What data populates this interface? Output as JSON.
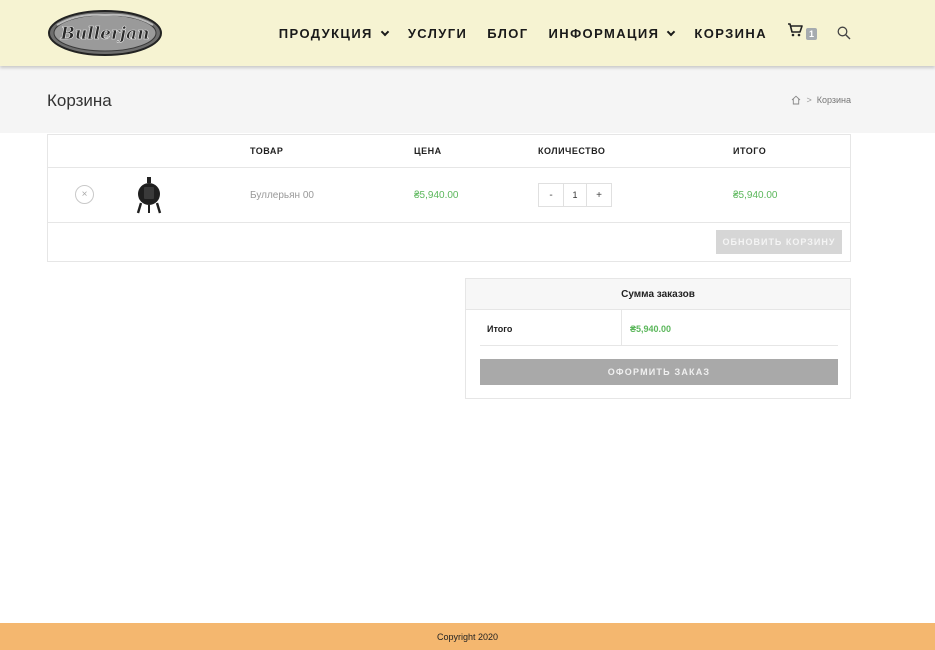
{
  "brand": {
    "logo_text": "Bullerjan"
  },
  "nav": {
    "items": [
      {
        "label": "ПРОДУКЦИЯ",
        "has_dropdown": true
      },
      {
        "label": "УСЛУГИ",
        "has_dropdown": false
      },
      {
        "label": "БЛОГ",
        "has_dropdown": false
      },
      {
        "label": "ИНФОРМАЦИЯ",
        "has_dropdown": true
      },
      {
        "label": "КОРЗИНА",
        "has_dropdown": false
      }
    ],
    "cart_count": "1",
    "cart_icon": "cart-icon",
    "search_icon": "search-icon"
  },
  "page": {
    "title": "Корзина",
    "breadcrumb": {
      "home_icon": "home-icon",
      "separator": ">",
      "current": "Корзина"
    }
  },
  "cart": {
    "headers": {
      "product": "ТОВАР",
      "price": "ЦЕНА",
      "quantity": "КОЛИЧЕСТВО",
      "subtotal": "ИТОГО"
    },
    "items": [
      {
        "remove": "×",
        "name": "Буллерьян 00",
        "price": "₴5,940.00",
        "qty_minus": "-",
        "quantity": "1",
        "qty_plus": "+",
        "subtotal": "₴5,940.00"
      }
    ],
    "update_label": "ОБНОВИТЬ КОРЗИНУ"
  },
  "totals": {
    "title": "Сумма заказов",
    "total_label": "Итого",
    "total_value": "₴5,940.00",
    "checkout_label": "ОФОРМИТЬ ЗАКАЗ"
  },
  "footer": {
    "copyright": "Copyright 2020"
  },
  "colors": {
    "header_bg": "#f6f3d2",
    "footer_bg": "#f4b76f",
    "price_green": "#5bb75b"
  }
}
